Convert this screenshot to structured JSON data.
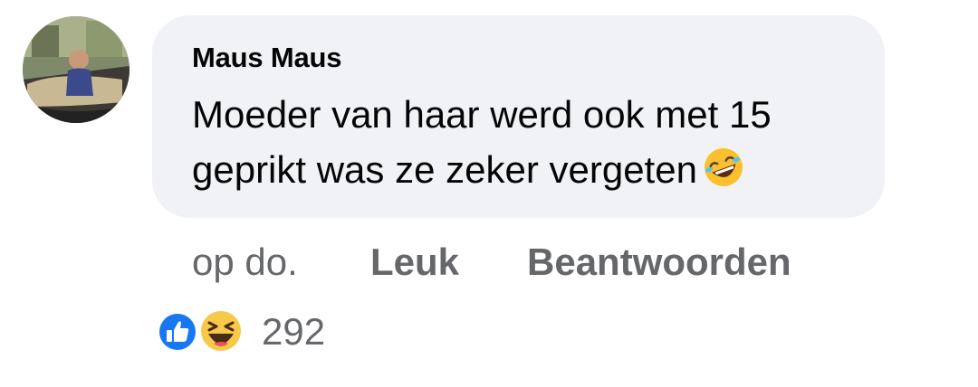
{
  "comment": {
    "author": "Maus Maus",
    "text": "Moeder van haar werd ook met 15 geprikt was ze zeker vergeten",
    "emoji_icon": "rolling-on-floor-laughing-icon"
  },
  "actions": {
    "timestamp": "op do.",
    "like_label": "Leuk",
    "reply_label": "Beantwoorden"
  },
  "reactions": {
    "icons": [
      "like-reaction-icon",
      "haha-reaction-icon"
    ],
    "count": "292"
  },
  "colors": {
    "bubble_bg": "#f0f2f5",
    "text": "#050505",
    "secondary_text": "#65676b",
    "like_blue": "#1877f2",
    "haha_yellow": "#f7c94b"
  }
}
